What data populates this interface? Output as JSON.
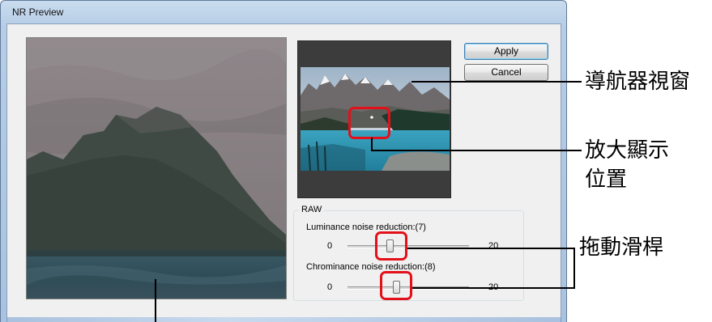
{
  "window": {
    "title": "NR Preview"
  },
  "buttons": {
    "apply_label": "Apply",
    "cancel_label": "Cancel"
  },
  "raw_group": {
    "legend": "RAW",
    "luminance": {
      "label": "Luminance noise reduction:(7)",
      "min": "0",
      "max": "20",
      "value": 7
    },
    "chrominance": {
      "label": "Chrominance noise reduction:(8)",
      "min": "0",
      "max": "20",
      "value": 8
    }
  },
  "callouts": {
    "navigator": "導航器視窗",
    "zoom_position_line1": "放大顯示",
    "zoom_position_line2": "位置",
    "drag_slider": "拖動滑桿"
  },
  "colors": {
    "highlight": "#e3101a",
    "apply_border": "#3c7fb1"
  }
}
